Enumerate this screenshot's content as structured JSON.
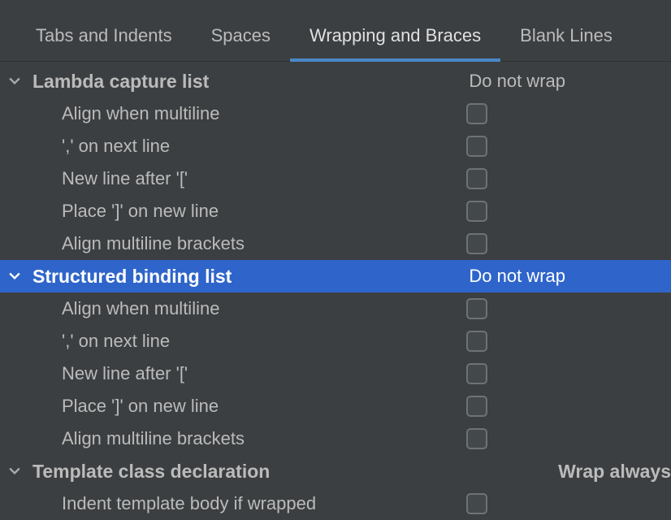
{
  "tabs": {
    "items": [
      {
        "label": "Tabs and Indents",
        "active": false
      },
      {
        "label": "Spaces",
        "active": false
      },
      {
        "label": "Wrapping and Braces",
        "active": true
      },
      {
        "label": "Blank Lines",
        "active": false
      }
    ]
  },
  "groups": [
    {
      "title": "Lambda capture list",
      "wrap_mode": "Do not wrap",
      "selected": false,
      "options": [
        {
          "label": "Align when multiline",
          "checked": false
        },
        {
          "label": "',' on next line",
          "checked": false
        },
        {
          "label": "New line after '['",
          "checked": false
        },
        {
          "label": "Place ']' on new line",
          "checked": false
        },
        {
          "label": "Align multiline brackets",
          "checked": false
        }
      ]
    },
    {
      "title": "Structured binding list",
      "wrap_mode": "Do not wrap",
      "selected": true,
      "options": [
        {
          "label": "Align when multiline",
          "checked": false
        },
        {
          "label": "',' on next line",
          "checked": false
        },
        {
          "label": "New line after '['",
          "checked": false
        },
        {
          "label": "Place ']' on new line",
          "checked": false
        },
        {
          "label": "Align multiline brackets",
          "checked": false
        }
      ]
    },
    {
      "title": "Template class declaration",
      "wrap_mode": "Wrap always",
      "selected": false,
      "options": [
        {
          "label": "Indent template body if wrapped",
          "checked": false
        }
      ]
    }
  ]
}
